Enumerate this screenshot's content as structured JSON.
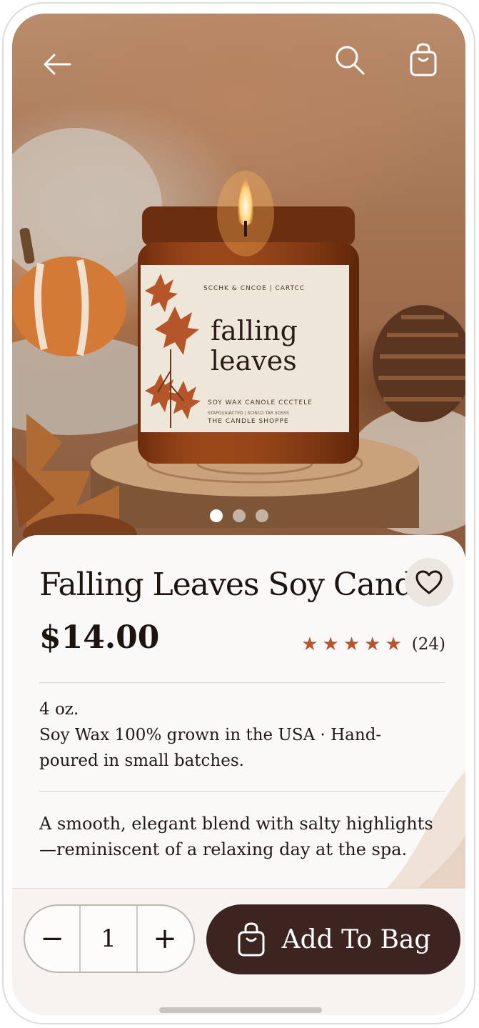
{
  "header": {
    "back_icon": "arrow-left-icon",
    "search_icon": "search-icon",
    "bag_icon": "shopping-bag-icon"
  },
  "hero": {
    "label_brand_line": "SCCHK & CNCOE | CARTCC",
    "label_name_line1": "falling",
    "label_name_line2": "leaves",
    "label_wax_line": "SOY WAX CANOLE CCCTELE",
    "label_small_line": "STAPO//AIACTED | SCINCO TAR SOSSS",
    "label_shop_line": "THE CANDLE SHOPPE",
    "carousel": {
      "count": 3,
      "active": 0
    }
  },
  "product": {
    "title": "Falling Leaves Soy Candle",
    "price": "$14.00",
    "rating": {
      "stars": 5,
      "count_label": "(24)"
    },
    "size": "4 oz.",
    "details": "Soy Wax 100% grown in the USA · Hand-poured in small batches.",
    "description": "A smooth, elegant blend with salty highlights—reminiscent of a relaxing day at the spa.",
    "favorite_icon": "heart-icon"
  },
  "purchase": {
    "decrement_label": "−",
    "quantity": "1",
    "increment_label": "+",
    "add_label": "Add To Bag",
    "add_icon": "shopping-bag-icon"
  },
  "colors": {
    "accent_dark": "#3c2521",
    "star": "#b4552f",
    "background": "#fbf9f7"
  }
}
